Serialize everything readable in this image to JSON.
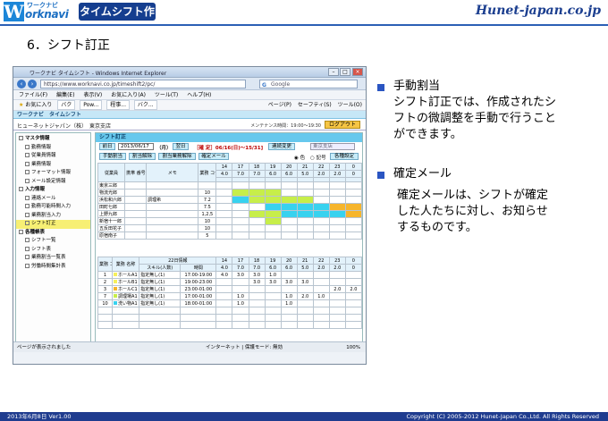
{
  "header": {
    "logo_letter": "W",
    "logo_small": "ワークナビ",
    "logo_brand": "orknavi",
    "title": "タイムシフト作成編",
    "site": "Hunet-japan.co.jp"
  },
  "section_title": "6．シフト訂正",
  "browser": {
    "window_title": "ワークナビ タイムシフト - Windows Internet Explorer",
    "url": "https://www.worknavi.co.jp/timeshift2/pc/",
    "search_placeholder": "Google",
    "search_icon_letter": "G",
    "menu": [
      "ファイル(F)",
      "編集(E)",
      "表示(V)",
      "お気に入り(A)",
      "ツール(T)",
      "ヘルプ(H)"
    ],
    "fav_label": "お気に入り",
    "fav_tabs": [
      "バク",
      "Pow...",
      "程事...",
      "バク..."
    ],
    "tools": [
      "ページ(P)",
      "セーフティ(S)",
      "ツール(O)"
    ],
    "status_left": "ページが表示されました",
    "status_mid": "インターネット | 保護モード: 無効",
    "status_zoom": "100%"
  },
  "app": {
    "bar": "ワークナビ　タイムシフト",
    "company": "ヒューネットジャパン（株）　東京支店",
    "maint": "メンテナンス時間：19:00～19:30",
    "logout": "ログアウト",
    "sidebar": [
      {
        "label": "マスタ情報",
        "type": "group"
      },
      {
        "label": "勤務情報",
        "type": "child"
      },
      {
        "label": "従業員情報",
        "type": "child"
      },
      {
        "label": "業務情報",
        "type": "child"
      },
      {
        "label": "フォーマット情報",
        "type": "child"
      },
      {
        "label": "メール設定情報",
        "type": "child"
      },
      {
        "label": "入力情報",
        "type": "group"
      },
      {
        "label": "連絡メール",
        "type": "child"
      },
      {
        "label": "勤務可能時間入力",
        "type": "child"
      },
      {
        "label": "業務割当入力",
        "type": "child"
      },
      {
        "label": "シフト訂正",
        "type": "child",
        "selected": true
      },
      {
        "label": "各種帳表",
        "type": "group"
      },
      {
        "label": "シフト一覧",
        "type": "child"
      },
      {
        "label": "シフト表",
        "type": "child"
      },
      {
        "label": "業務割当一覧表",
        "type": "child"
      },
      {
        "label": "労働時間集計表",
        "type": "child"
      }
    ],
    "main_title": "シフト訂正",
    "prev_btn": "前日",
    "date": "2013/06/17",
    "weekday": "（月）",
    "next_btn": "翌日",
    "period": "［確 定］06/16(日)～15/31]",
    "confirm_change": "連続変更",
    "store_select": "東京支店",
    "buttons": [
      "手動割当",
      "割当解除",
      "割当業務解除",
      "確定メール"
    ],
    "radio_labels": [
      "色",
      "記号"
    ],
    "settings_btn": "各種設定",
    "top_headers": [
      "従業員",
      "携帯\n番号",
      "メモ",
      "業務\nコード"
    ],
    "hours": [
      "14",
      "17",
      "18",
      "19",
      "20",
      "21",
      "22",
      "23",
      "0"
    ],
    "hour_totals": [
      "4.0",
      "7.0",
      "7.0",
      "6.0",
      "6.0",
      "5.0",
      "2.0",
      "2.0",
      "0"
    ],
    "employees": [
      {
        "name": "東京三郎",
        "memo": "",
        "hours": ""
      },
      {
        "name": "物流光郎",
        "memo": "",
        "hours": "10"
      },
      {
        "name": "浜松和六郎",
        "memo": "調理希",
        "hours": "7.2"
      },
      {
        "name": "田町七郎",
        "memo": "",
        "hours": "7.5"
      },
      {
        "name": "上野九郎",
        "memo": "",
        "hours": "1,2,5"
      },
      {
        "name": "新宿十一郎",
        "memo": "",
        "hours": "10"
      },
      {
        "name": "五反田花子",
        "memo": "",
        "hours": "10"
      },
      {
        "name": "原宿南子",
        "memo": "",
        "hours": "5"
      }
    ],
    "bottom_headers": [
      "業務\nコード",
      "業務\n名称",
      "スキル(人数)",
      "時間"
    ],
    "bottom_group_label": "22日情報",
    "bottom_rows": [
      {
        "code": "1",
        "name": "ホールA1",
        "skill": "指定無し(1)",
        "time": "17:00-19:00",
        "vals": [
          "4.0",
          "3.0",
          "3.0",
          "1.0",
          "",
          "",
          "",
          "",
          ""
        ]
      },
      {
        "code": "2",
        "name": "ホールB1",
        "skill": "指定無し(1)",
        "time": "19:00-23:00",
        "vals": [
          "",
          "",
          "3.0",
          "3.0",
          "3.0",
          "3.0",
          "",
          "",
          ""
        ]
      },
      {
        "code": "3",
        "name": "ホールC1",
        "skill": "指定無し(1)",
        "time": "23:00-01:00",
        "vals": [
          "",
          "",
          "",
          "",
          "",
          "",
          "",
          "2.0",
          "2.0"
        ]
      },
      {
        "code": "7",
        "name": "調理場A1",
        "skill": "指定無し(1)",
        "time": "17:00-01:00",
        "vals": [
          "",
          "1.0",
          "",
          "",
          "1.0",
          "2.0",
          "1.0",
          "",
          ""
        ]
      },
      {
        "code": "10",
        "name": "洗い物A1",
        "skill": "指定無し(1)",
        "time": "18:00-01:00",
        "vals": [
          "",
          "1.0",
          "",
          "",
          "1.0",
          "",
          "",
          "",
          ""
        ]
      }
    ]
  },
  "bullets": [
    {
      "title": "手動割当",
      "body": [
        "シフト訂正では、作成されたシ",
        "フトの微調整を手動で行うこと",
        "ができます。"
      ]
    },
    {
      "title": "確定メール",
      "body": [
        "確定メールは、シフトが確定",
        "した人たちに対し、お知らせ",
        "するものです。"
      ]
    }
  ],
  "footer": {
    "left": "2013年6月8日 Ver1.00",
    "right": "Copyright (C) 2005-2012 Hunet-Japan Co.,Ltd. All Rights Reserved"
  },
  "colors": {
    "brand_blue": "#153e8f",
    "header_line": "#2b5fb5",
    "bar_green": "#c7ee4a",
    "bar_cyan": "#38d2ef",
    "bar_orange": "#f6b52c",
    "selected_yellow": "#f7ef74"
  }
}
